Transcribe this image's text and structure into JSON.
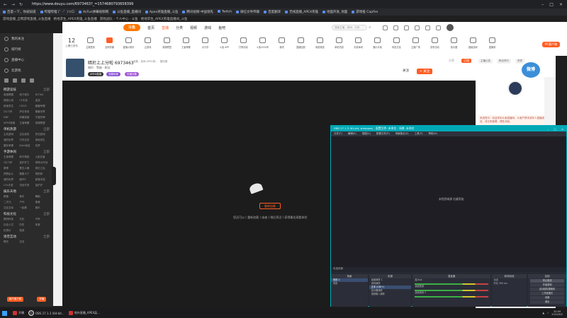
{
  "browser": {
    "url": "https://www.douyu.com/6973463?_=1574680793658399",
    "bookmarks": [
      "百度一下，你就知道",
      "哔哩哔哩 (゜-゜)つロ",
      "AcFun弹幕视频网",
      "斗鱼直播_直播间",
      "Apex英雄直播_斗鱼",
      "腾讯视频-中国领先",
      "Twitch",
      "微信文件传输",
      "百度翻译",
      "无线直播_APEX英雄",
      "地面开发_地面",
      "游戏框 Capfire"
    ],
    "tabs": [
      "游戏直播_全网游戏直播_斗鱼直播",
      "绝地求生_APEX英雄_斗鱼直播",
      "游戏战队 - 个人中心 - 斗鱼",
      "绝地求生_APEX英雄直播间_斗鱼"
    ]
  },
  "sidebar": {
    "nav": [
      "我的关注",
      "排行榜",
      "直播中心",
      "云游戏"
    ],
    "sections": [
      {
        "title": "网游竞技",
        "more": "全部",
        "items": [
          "英雄联盟",
          "地下城与",
          "DOTA2",
          "穿越火线",
          "CF手游",
          "逆战",
          "绝地求生",
          "CSGO",
          "魔兽争霸",
          "QQ飞车",
          "炉石传说",
          "魔兽世界",
          "DNF",
          "风暴英雄",
          "守望先锋",
          "APEX英雄",
          "王者荣耀",
          "英雄联盟"
        ]
      },
      {
        "title": "单机热游",
        "more": "全部",
        "items": [
          "主机游戏",
          "生化危机",
          "怀旧游戏",
          "我的世界",
          "方舟生存",
          "绝地求生",
          "星际争霸",
          "Dota自走",
          "饥荒"
        ]
      },
      {
        "title": "手游休闲",
        "more": "全部",
        "items": [
          "王者荣耀",
          "和平精英",
          "火影忍者",
          "QQ飞车",
          "金铲铲之",
          "球球大作战",
          "原神",
          "第五人格",
          "明日之后",
          "荒野乱斗",
          "跑跑卡丁",
          "阴阳师",
          "我的世界",
          "崩坏3",
          "部落冲突",
          "LOL手游",
          "决战平安",
          "金铲铲"
        ]
      },
      {
        "title": "娱乐天地",
        "more": "全部",
        "items": [
          "颜值",
          "音乐",
          "舞蹈",
          "二次元",
          "户外",
          "美食",
          "交友互动",
          "一起看",
          "娱乐"
        ]
      },
      {
        "title": "科技文化",
        "more": "全部",
        "items": [
          "数码科技",
          "文化",
          "汽车",
          "社会人文",
          "历史",
          "军事",
          "纪录片",
          "旅游"
        ]
      },
      {
        "title": "语音互动",
        "more": "全部",
        "items": [
          "聊天",
          "交友"
        ]
      }
    ],
    "promo": [
      "客户端下载",
      "开播"
    ]
  },
  "header": {
    "logo": "斗鱼",
    "nav": [
      "首页",
      "直播",
      "分类",
      "视频",
      "游戏",
      "鱼吧"
    ],
    "active_nav": "直播",
    "search_placeholder": "搜索主播、房间、分类"
  },
  "categories": {
    "date_day": "12",
    "date_label": "上期已发布",
    "items": [
      "主播签到",
      "全网热播",
      "直播小助手",
      "云游戏",
      "英雄联盟",
      "王者荣耀",
      "大分享",
      "斗鱼 APP",
      "打榜活动",
      "斗鱼2020年",
      "鱼吧",
      "直播回放",
      "网游竞技",
      "单机热游",
      "手游休闲",
      "娱乐天地",
      "科技文化",
      "主播广场",
      "赛事活动",
      "鱼乐圈",
      "超级游戏",
      "直播房",
      "鱼宝商城",
      "新闻",
      "粉丝牌",
      "勋章",
      "鱼丸",
      "鱼翅",
      "背包",
      "我的"
    ],
    "pc_client": "PC客户端"
  },
  "room": {
    "title": "暗珩上上分啦 6973463",
    "meta": "装备 · 游戏 APEX英... · 国际服",
    "anchor": "暗珩 · 等级 · 粉丝",
    "tags": [
      "APEX英雄",
      "亚服玩家",
      "天梯分数"
    ],
    "follow_count": "关注",
    "follow_label": "+ 关注",
    "share": "分享",
    "subscribe": "订阅"
  },
  "player": {
    "refresh": "重新加载",
    "message": "您还可以 ( 重新加载 ) 或者 ( 稍后再试 ) 获得最佳观看体验"
  },
  "chat": {
    "tabs": [
      "主播公告",
      "粉丝排行",
      "贵宾"
    ],
    "weibo": "微博",
    "notice": "系统提示：欢迎来到斗鱼直播间，斗鱼严禁未成年人直播或打赏，请文明观看，理性消费。"
  },
  "obs": {
    "title": "OBS 27.1.3 (64-bit, windows) - 配置文件: 未命名 - 场景: 未命名",
    "menu": [
      "文件(F)",
      "编辑(E)",
      "视图(V)",
      "配置文件(P)",
      "场景集合(S)",
      "工具(T)",
      "帮助(H)"
    ],
    "no_source": "未找到来源\n右键添加",
    "scene_label": "未选择源",
    "docks": {
      "scenes": {
        "title": "场景",
        "items": [
          "场景 2",
          "场景"
        ]
      },
      "sources": {
        "title": "来源",
        "items": [
          "画面捕获 1",
          "游戏捕获",
          "文本 (GDI+)",
          "显示器捕获",
          "音频输入捕获"
        ]
      },
      "mixer": {
        "title": "混音器",
        "items": [
          "麦/Aux",
          "桌面音频",
          "桌面音频 2"
        ]
      },
      "transitions": {
        "title": "转场特效",
        "items": [
          "淡出",
          "时长 300 ms"
        ]
      },
      "controls": {
        "title": "控制",
        "items": [
          "停止推流",
          "开始录制",
          "启动虚拟摄像机",
          "工作室模式",
          "设置",
          "退出"
        ]
      }
    }
  },
  "taskbar": {
    "apps": [
      "开播",
      "OBS 27.1.3 (64-bit...",
      "地外直播_APEX英..."
    ],
    "time": "20:09",
    "date": "2022/6/2"
  }
}
